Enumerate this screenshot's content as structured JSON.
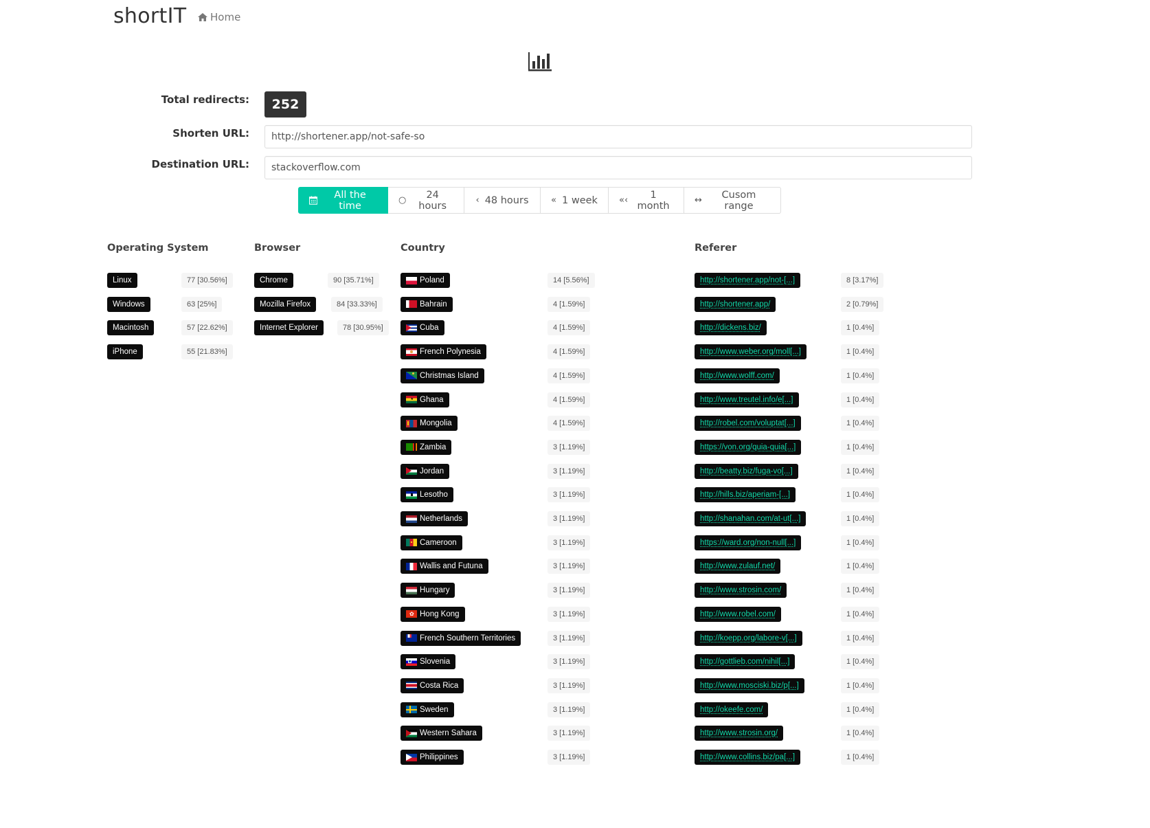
{
  "header": {
    "brand": "shortIT",
    "home_label": "Home",
    "home_icon": "home-icon",
    "stats_icon": "bar-chart-icon"
  },
  "summary": {
    "total_label": "Total redirects:",
    "total_value": "252",
    "shorten_label": "Shorten URL:",
    "shorten_value": "http://shortener.app/not-safe-so",
    "destination_label": "Destination URL:",
    "destination_value": "stackoverflow.com"
  },
  "ranges": [
    {
      "label": "All the time",
      "icon": "calendar-icon",
      "active": true
    },
    {
      "label": "24 hours",
      "icon": "circle-icon",
      "active": false
    },
    {
      "label": "48 hours",
      "icon": "angle-left-icon",
      "active": false
    },
    {
      "label": "1 week",
      "icon": "angle-double-left-icon",
      "active": false
    },
    {
      "label": "1 month",
      "icon": "triple-angle-left-icon",
      "active": false
    },
    {
      "label": "Cusom range",
      "icon": "arrows-h-icon",
      "active": false
    }
  ],
  "accent_color": "#00c9a7",
  "sections": {
    "os": {
      "title": "Operating System",
      "items": [
        {
          "name": "Linux",
          "count": "77 [30.56%]"
        },
        {
          "name": "Windows",
          "count": "63 [25%]"
        },
        {
          "name": "Macintosh",
          "count": "57 [22.62%]"
        },
        {
          "name": "iPhone",
          "count": "55 [21.83%]"
        }
      ]
    },
    "browser": {
      "title": "Browser",
      "items": [
        {
          "name": "Chrome",
          "count": "90 [35.71%]"
        },
        {
          "name": "Mozilla Firefox",
          "count": "84 [33.33%]"
        },
        {
          "name": "Internet Explorer",
          "count": "78 [30.95%]"
        }
      ]
    },
    "country": {
      "title": "Country",
      "items": [
        {
          "name": "Poland",
          "flag": "pl",
          "count": "14 [5.56%]"
        },
        {
          "name": "Bahrain",
          "flag": "bh",
          "count": "4 [1.59%]"
        },
        {
          "name": "Cuba",
          "flag": "cu",
          "count": "4 [1.59%]"
        },
        {
          "name": "French Polynesia",
          "flag": "pf",
          "count": "4 [1.59%]"
        },
        {
          "name": "Christmas Island",
          "flag": "cx",
          "count": "4 [1.59%]"
        },
        {
          "name": "Ghana",
          "flag": "gh",
          "count": "4 [1.59%]"
        },
        {
          "name": "Mongolia",
          "flag": "mn",
          "count": "4 [1.59%]"
        },
        {
          "name": "Zambia",
          "flag": "zm",
          "count": "3 [1.19%]"
        },
        {
          "name": "Jordan",
          "flag": "jo",
          "count": "3 [1.19%]"
        },
        {
          "name": "Lesotho",
          "flag": "ls",
          "count": "3 [1.19%]"
        },
        {
          "name": "Netherlands",
          "flag": "nl",
          "count": "3 [1.19%]"
        },
        {
          "name": "Cameroon",
          "flag": "cm",
          "count": "3 [1.19%]"
        },
        {
          "name": "Wallis and Futuna",
          "flag": "wf",
          "count": "3 [1.19%]"
        },
        {
          "name": "Hungary",
          "flag": "hu",
          "count": "3 [1.19%]"
        },
        {
          "name": "Hong Kong",
          "flag": "hk",
          "count": "3 [1.19%]"
        },
        {
          "name": "French Southern Territories",
          "flag": "tf",
          "count": "3 [1.19%]"
        },
        {
          "name": "Slovenia",
          "flag": "si",
          "count": "3 [1.19%]"
        },
        {
          "name": "Costa Rica",
          "flag": "cr",
          "count": "3 [1.19%]"
        },
        {
          "name": "Sweden",
          "flag": "se",
          "count": "3 [1.19%]"
        },
        {
          "name": "Western Sahara",
          "flag": "eh",
          "count": "3 [1.19%]"
        },
        {
          "name": "Philippines",
          "flag": "ph",
          "count": "3 [1.19%]"
        }
      ]
    },
    "referer": {
      "title": "Referer",
      "items": [
        {
          "url": "http://shortener.app/not-[...]",
          "count": "8 [3.17%]"
        },
        {
          "url": "http://shortener.app/",
          "count": "2 [0.79%]"
        },
        {
          "url": "http://dickens.biz/",
          "count": "1 [0.4%]"
        },
        {
          "url": "http://www.weber.org/moll[...]",
          "count": "1 [0.4%]"
        },
        {
          "url": "http://www.wolff.com/",
          "count": "1 [0.4%]"
        },
        {
          "url": "http://www.treutel.info/e[...]",
          "count": "1 [0.4%]"
        },
        {
          "url": "http://robel.com/voluptat[...]",
          "count": "1 [0.4%]"
        },
        {
          "url": "https://von.org/quia-quia[...]",
          "count": "1 [0.4%]"
        },
        {
          "url": "http://beatty.biz/fuga-vo[...]",
          "count": "1 [0.4%]"
        },
        {
          "url": "http://hills.biz/aperiam-[...]",
          "count": "1 [0.4%]"
        },
        {
          "url": "http://shanahan.com/at-ut[...]",
          "count": "1 [0.4%]"
        },
        {
          "url": "https://ward.org/non-null[...]",
          "count": "1 [0.4%]"
        },
        {
          "url": "http://www.zulauf.net/",
          "count": "1 [0.4%]"
        },
        {
          "url": "http://www.strosin.com/",
          "count": "1 [0.4%]"
        },
        {
          "url": "http://www.robel.com/",
          "count": "1 [0.4%]"
        },
        {
          "url": "http://koepp.org/labore-v[...]",
          "count": "1 [0.4%]"
        },
        {
          "url": "http://gottlieb.com/nihil[...]",
          "count": "1 [0.4%]"
        },
        {
          "url": "http://www.mosciski.biz/p[...]",
          "count": "1 [0.4%]"
        },
        {
          "url": "http://okeefe.com/",
          "count": "1 [0.4%]"
        },
        {
          "url": "http://www.strosin.org/",
          "count": "1 [0.4%]"
        },
        {
          "url": "http://www.collins.biz/pa[...]",
          "count": "1 [0.4%]"
        }
      ]
    }
  }
}
